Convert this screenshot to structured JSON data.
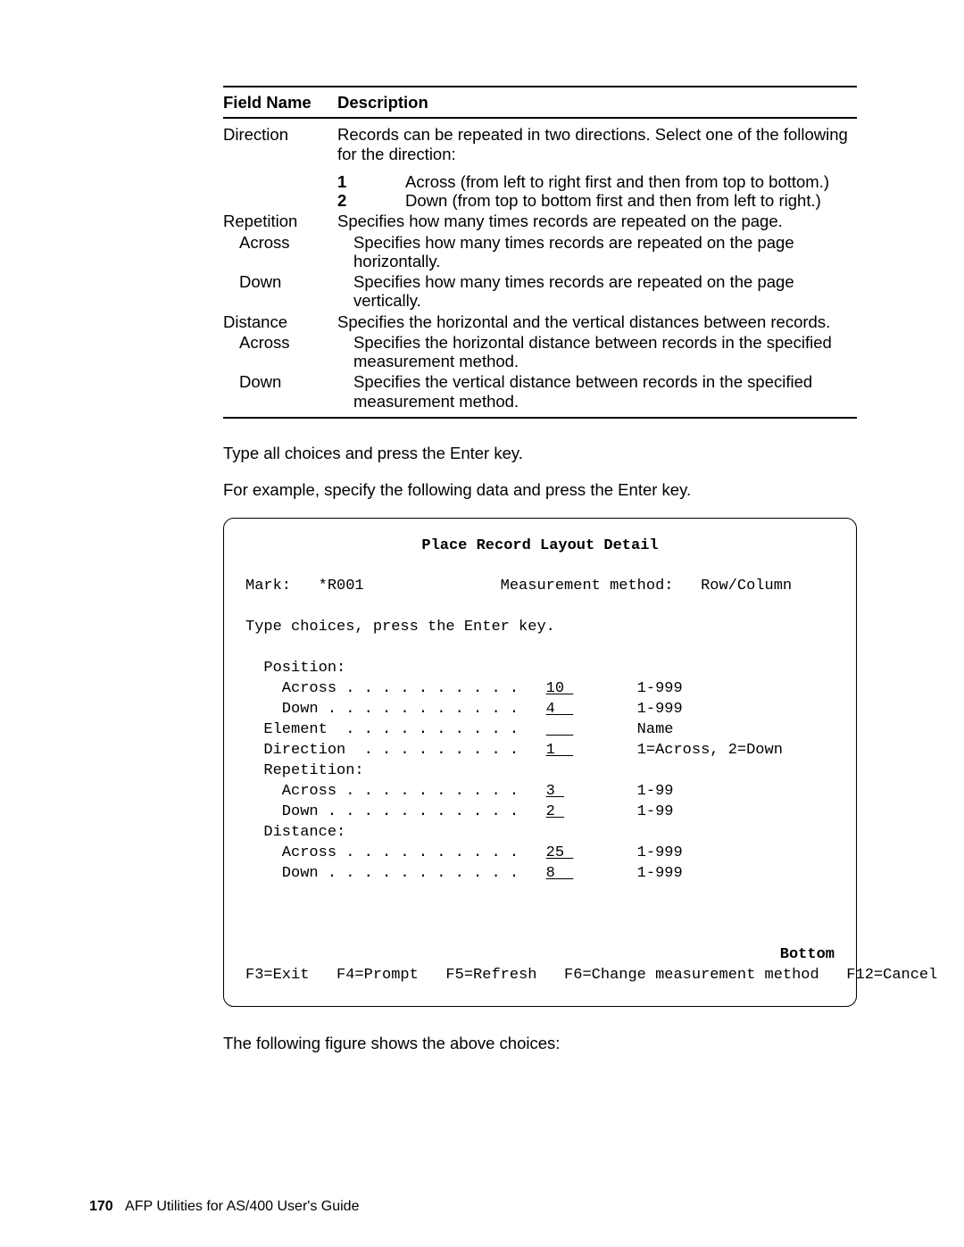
{
  "table": {
    "head_field": "Field Name",
    "head_desc": "Description",
    "direction_label": "Direction",
    "direction_desc": "Records can be repeated in two directions.  Select one of the following for the direction:",
    "enum1_num": "1",
    "enum1_text": "Across (from left to right first and then from top to bottom.)",
    "enum2_num": "2",
    "enum2_text": "Down (from top to bottom first and then from left to right.)",
    "repetition_label": "Repetition",
    "repetition_desc": "Specifies how many times records are repeated on the page.",
    "rep_across_label": "Across",
    "rep_across_desc": "Specifies how many times records are repeated on the page horizontally.",
    "rep_down_label": "Down",
    "rep_down_desc": "Specifies how many times records are repeated on the page vertically.",
    "distance_label": "Distance",
    "distance_desc": "Specifies the horizontal and the vertical distances between records.",
    "dist_across_label": "Across",
    "dist_across_desc": "Specifies the horizontal distance between records in the specified measurement method.",
    "dist_down_label": "Down",
    "dist_down_desc": "Specifies the vertical distance between records in the specified measurement method."
  },
  "para1": "Type all choices and press the Enter key.",
  "para2": "For example, specify the following data and press the Enter key.",
  "screen": {
    "title": "Place Record Layout Detail",
    "mark_line": "Mark:   *R001               Measurement method:   Row/Column",
    "instruct": "Type choices, press the Enter key.",
    "position_label": "  Position:",
    "pos_across": "    Across . . . . . . . . . .   ",
    "pos_across_val": "10 ",
    "pos_across_range": "       1-999",
    "pos_down": "    Down . . . . . . . . . . .   ",
    "pos_down_val": "4  ",
    "pos_down_range": "       1-999",
    "element": "  Element  . . . . . . . . . .   ",
    "element_val": "   ",
    "element_range": "       Name",
    "direction": "  Direction  . . . . . . . . .   ",
    "direction_val": "1  ",
    "direction_range": "       1=Across, 2=Down",
    "repetition": "  Repetition:",
    "rep_across": "    Across . . . . . . . . . .   ",
    "rep_across_val": "3 ",
    "rep_across_range": "        1-99",
    "rep_down": "    Down . . . . . . . . . . .   ",
    "rep_down_val": "2 ",
    "rep_down_range": "        1-99",
    "distance": "  Distance:",
    "dist_across": "    Across . . . . . . . . . .   ",
    "dist_across_val": "25 ",
    "dist_across_range": "       1-999",
    "dist_down": "    Down . . . . . . . . . . .   ",
    "dist_down_val": "8  ",
    "dist_down_range": "       1-999",
    "bottom": "Bottom",
    "fkeys": "F3=Exit   F4=Prompt   F5=Refresh   F6=Change measurement method   F12=Cancel"
  },
  "para3": "The following figure shows the above choices:",
  "footer": {
    "page_num": "170",
    "book": "AFP Utilities for AS/400 User's Guide"
  }
}
